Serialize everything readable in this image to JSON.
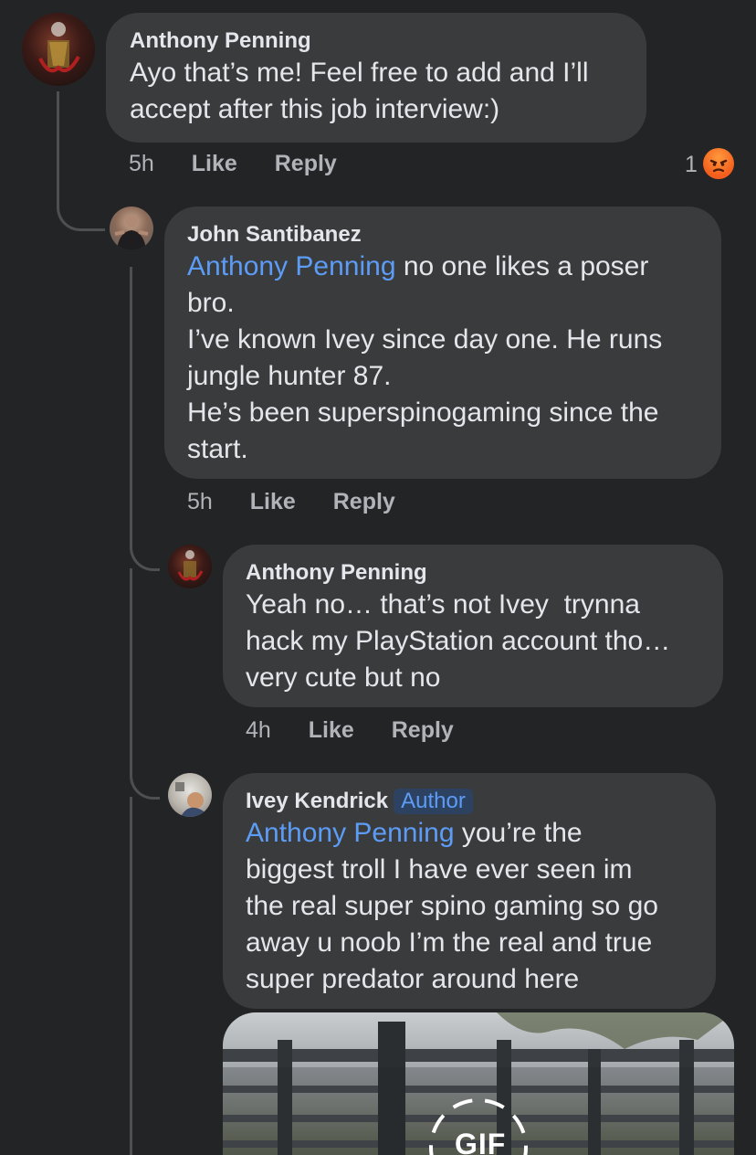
{
  "comments": [
    {
      "author": "Anthony Penning",
      "text": "Ayo that’s me! Feel free to add and I’ll accept after this job interview:)",
      "lines": [
        "Ayo that’s me! Feel free to add and I’ll",
        "accept after this job interview:)"
      ],
      "time": "5h",
      "like_label": "Like",
      "reply_label": "Reply",
      "reaction_count": "1",
      "reaction_icon": "angry-reaction-icon"
    },
    {
      "author": "John Santibanez",
      "mention": "Anthony Penning",
      "lines": [
        " no one likes a poser",
        "bro.",
        "I’ve known Ivey since day one. He runs",
        "jungle hunter 87.",
        "He’s been superspinogaming since the",
        "start."
      ],
      "time": "5h",
      "like_label": "Like",
      "reply_label": "Reply"
    },
    {
      "author": "Anthony Penning",
      "lines": [
        "Yeah no… that’s not Ivey  trynna",
        "hack my PlayStation account tho…",
        "very cute but no"
      ],
      "time": "4h",
      "like_label": "Like",
      "reply_label": "Reply"
    },
    {
      "author": "Ivey Kendrick",
      "badge": "Author",
      "mention": "Anthony Penning",
      "lines": [
        " you’re the",
        "biggest troll I have ever seen im",
        "the real super spino gaming so go",
        "away u noob I’m the real and true",
        "super predator around here"
      ],
      "gif_label": "GIF"
    }
  ],
  "colors": {
    "background": "#232426",
    "bubble": "#3a3b3c",
    "mention": "#5d9cf6",
    "meta": "#b0b3b8",
    "angry_reaction": "#f35d1d"
  }
}
